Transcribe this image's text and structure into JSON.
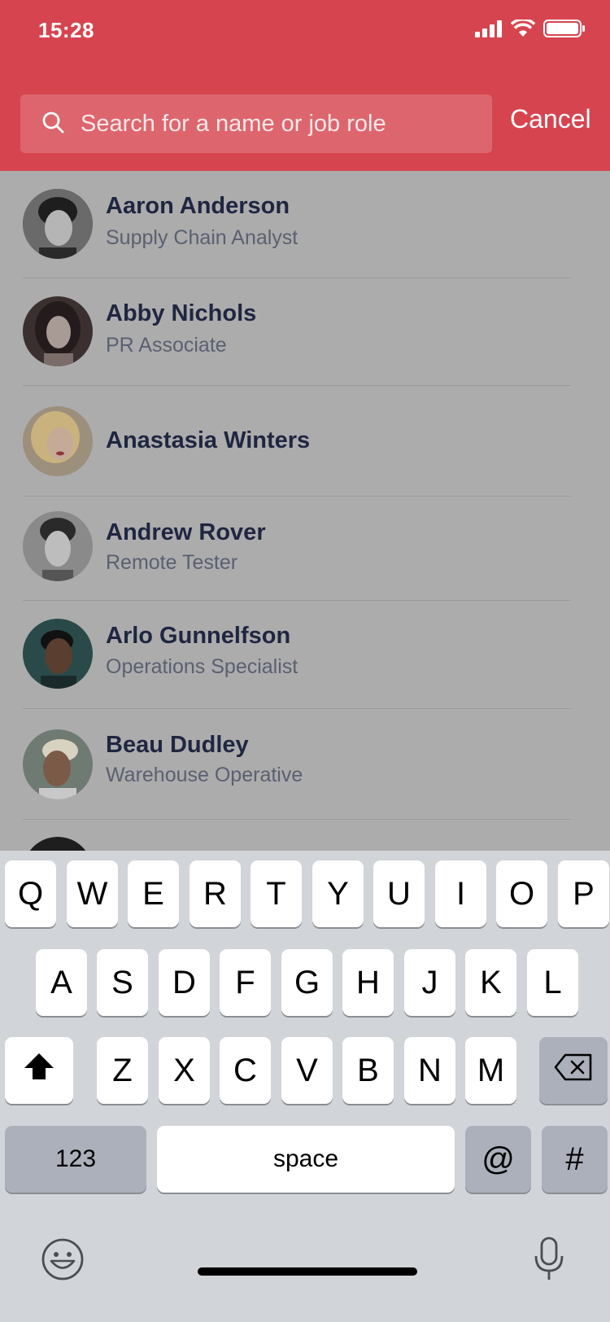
{
  "status": {
    "time": "15:28"
  },
  "search": {
    "placeholder": "Search for a name or job role",
    "cancel_label": "Cancel"
  },
  "people": [
    {
      "name": "Aaron Anderson",
      "role": "Supply Chain Analyst"
    },
    {
      "name": "Abby Nichols",
      "role": "PR Associate"
    },
    {
      "name": "Anastasia Winters",
      "role": ""
    },
    {
      "name": "Andrew Rover",
      "role": "Remote Tester"
    },
    {
      "name": "Arlo Gunnelfson",
      "role": "Operations Specialist"
    },
    {
      "name": "Beau Dudley",
      "role": "Warehouse Operative"
    }
  ],
  "keyboard": {
    "row1": [
      "Q",
      "W",
      "E",
      "R",
      "T",
      "Y",
      "U",
      "I",
      "O",
      "P"
    ],
    "row2": [
      "A",
      "S",
      "D",
      "F",
      "G",
      "H",
      "J",
      "K",
      "L"
    ],
    "row3": [
      "Z",
      "X",
      "C",
      "V",
      "B",
      "N",
      "M"
    ],
    "numbers_label": "123",
    "space_label": "space",
    "at_label": "@",
    "hash_label": "#"
  },
  "colors": {
    "header": "#d6454f",
    "overlay": "#acacad",
    "keyboard": "#d1d4d9"
  }
}
